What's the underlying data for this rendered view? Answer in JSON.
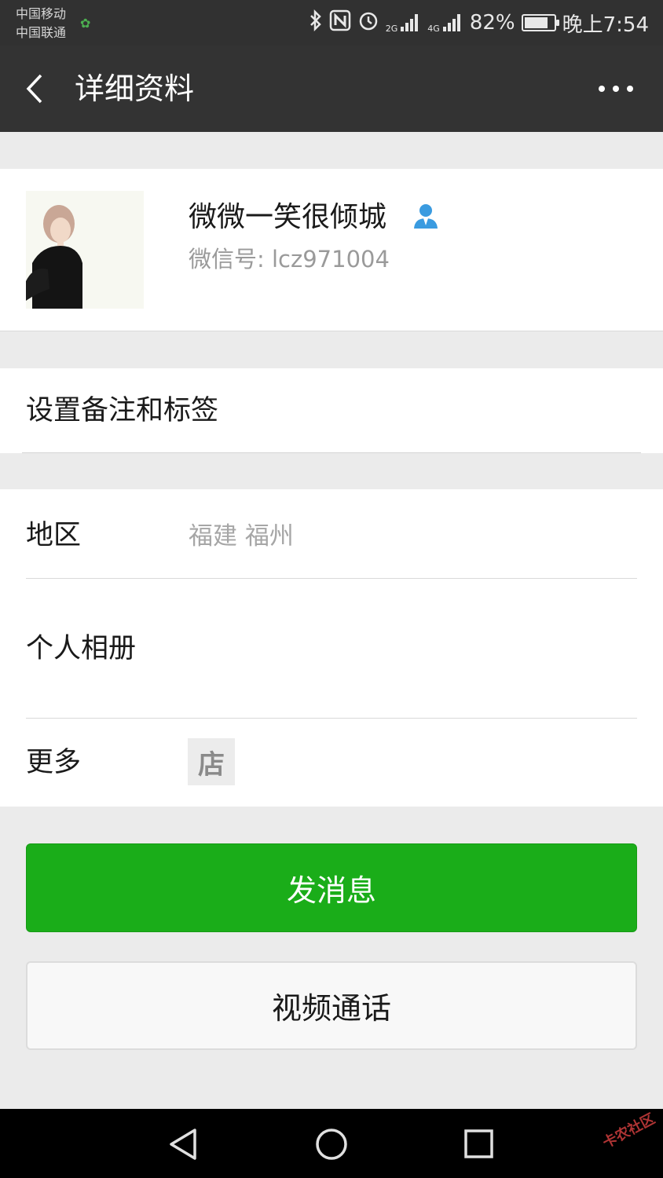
{
  "status_bar": {
    "carriers": [
      "中国移动",
      "中国联通"
    ],
    "net_2g": "2G",
    "net_4g": "4G",
    "battery_level": 0.82,
    "battery_text": "82%",
    "time": "晚上7:54"
  },
  "nav": {
    "title": "详细资料"
  },
  "profile": {
    "nickname": "微微一笑很倾城",
    "wechat_id": "微信号: lcz971004"
  },
  "remarks": {
    "label": "设置备注和标签"
  },
  "info": {
    "region_label": "地区",
    "region_value": "福建  福州",
    "album_label": "个人相册",
    "more_label": "更多",
    "shop_icon_glyph": "店"
  },
  "buttons": {
    "send_message": "发消息",
    "video_call": "视频通话"
  },
  "watermark": "卡农社区",
  "colors": {
    "primary_green": "#1aad19",
    "nav_bg": "#333333",
    "page_bg": "#ebebeb",
    "id_person_icon": "#3a9be0"
  }
}
